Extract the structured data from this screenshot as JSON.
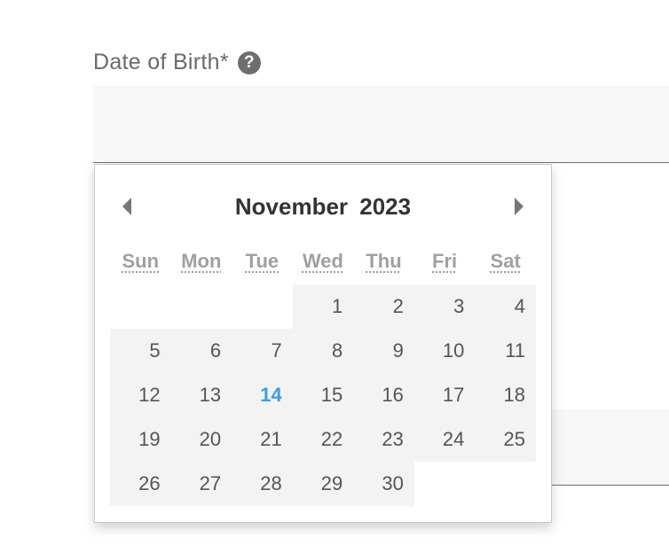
{
  "form": {
    "label": "Date of Birth*",
    "help_icon": "?"
  },
  "datepicker": {
    "month": "November",
    "year": "2023",
    "weekdays": [
      "Sun",
      "Mon",
      "Tue",
      "Wed",
      "Thu",
      "Fri",
      "Sat"
    ],
    "weeks": [
      [
        "",
        "",
        "",
        "1",
        "2",
        "3",
        "4"
      ],
      [
        "5",
        "6",
        "7",
        "8",
        "9",
        "10",
        "11"
      ],
      [
        "12",
        "13",
        "14",
        "15",
        "16",
        "17",
        "18"
      ],
      [
        "19",
        "20",
        "21",
        "22",
        "23",
        "24",
        "25"
      ],
      [
        "26",
        "27",
        "28",
        "29",
        "30",
        "",
        ""
      ]
    ],
    "today": "14",
    "prev_icon": "triangle-left-icon",
    "next_icon": "triangle-right-icon",
    "highlight_color": "#3a9ee0"
  }
}
